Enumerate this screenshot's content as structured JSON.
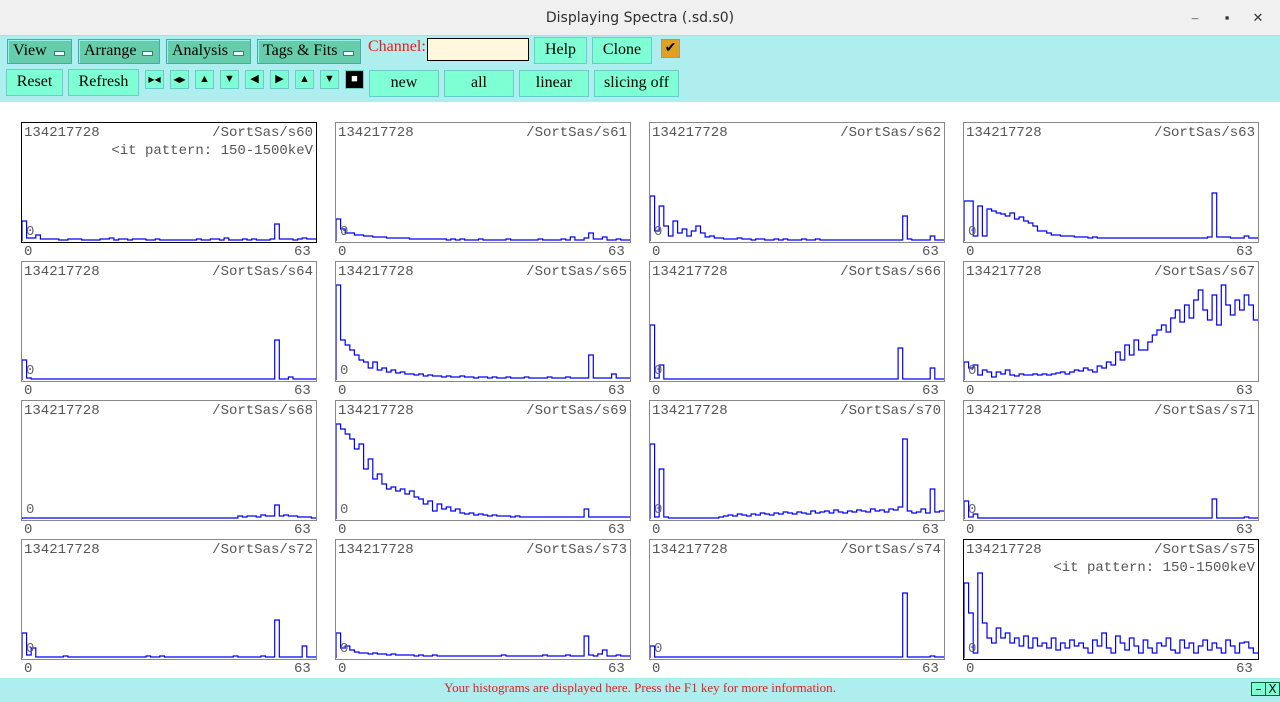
{
  "window": {
    "title": "Displaying Spectra (.sd.s0)",
    "minimize": "–",
    "maximize": "▪",
    "close": "✕"
  },
  "menus": [
    {
      "label": "View"
    },
    {
      "label": "Arrange"
    },
    {
      "label": "Analysis"
    },
    {
      "label": "Tags & Fits"
    }
  ],
  "channel": {
    "label": "Channel:",
    "value": ""
  },
  "buttons": {
    "help": "Help",
    "clone": "Clone",
    "reset": "Reset",
    "refresh": "Refresh",
    "new": "new",
    "all": "all",
    "linear": "linear",
    "slicing": "slicing off",
    "checkbox": "✔"
  },
  "nav_icons": [
    "▶◀",
    "◀▶",
    "▲",
    "▼",
    "◀",
    "▶",
    "▲",
    "▼",
    "■"
  ],
  "status": {
    "message": "Your histograms are displayed here. Press the F1 key for more information.",
    "minimize": "–",
    "close": "X"
  },
  "axis": {
    "min": "0",
    "max": "63",
    "zero": "0"
  },
  "spectra": [
    {
      "count": "134217728",
      "name": "/SortSas/s60",
      "subtitle": "<it pattern: 150-1500keV",
      "selected": true,
      "values": [
        20,
        3,
        3,
        6,
        2,
        2,
        2,
        2,
        1,
        1,
        2,
        2,
        2,
        1,
        1,
        1,
        1,
        2,
        2,
        3,
        1,
        2,
        2,
        1,
        2,
        2,
        2,
        1,
        1,
        2,
        1,
        1,
        1,
        1,
        1,
        1,
        1,
        1,
        2,
        1,
        1,
        2,
        2,
        1,
        3,
        1,
        1,
        1,
        2,
        1,
        2,
        1,
        1,
        1,
        2,
        17,
        2,
        2,
        2,
        1,
        2,
        3,
        2,
        2
      ]
    },
    {
      "count": "134217728",
      "name": "/SortSas/s61",
      "values": [
        22,
        12,
        8,
        8,
        6,
        6,
        5,
        5,
        4,
        4,
        4,
        3,
        3,
        3,
        3,
        3,
        2,
        2,
        2,
        2,
        2,
        2,
        2,
        2,
        1,
        2,
        1,
        2,
        1,
        1,
        1,
        2,
        1,
        1,
        1,
        1,
        1,
        2,
        1,
        1,
        1,
        1,
        1,
        1,
        2,
        1,
        1,
        1,
        1,
        2,
        1,
        4,
        1,
        1,
        3,
        8,
        2,
        2,
        4,
        1,
        1,
        2,
        1,
        1
      ]
    },
    {
      "count": "134217728",
      "name": "/SortSas/s62",
      "values": [
        45,
        10,
        35,
        15,
        5,
        20,
        8,
        12,
        5,
        10,
        15,
        8,
        4,
        5,
        3,
        3,
        2,
        2,
        2,
        3,
        2,
        2,
        1,
        2,
        2,
        1,
        1,
        2,
        1,
        2,
        1,
        1,
        1,
        2,
        1,
        1,
        2,
        1,
        1,
        1,
        1,
        1,
        1,
        1,
        1,
        1,
        1,
        1,
        1,
        1,
        1,
        1,
        1,
        1,
        1,
        25,
        2,
        1,
        1,
        1,
        1,
        5,
        1,
        1
      ]
    },
    {
      "count": "134217728",
      "name": "/SortSas/s63",
      "values": [
        40,
        40,
        5,
        35,
        5,
        32,
        30,
        28,
        27,
        25,
        28,
        22,
        24,
        20,
        18,
        15,
        10,
        10,
        8,
        6,
        6,
        5,
        5,
        5,
        4,
        4,
        4,
        3,
        4,
        3,
        3,
        3,
        3,
        3,
        3,
        3,
        3,
        3,
        3,
        3,
        3,
        3,
        3,
        3,
        3,
        3,
        3,
        3,
        3,
        3,
        3,
        3,
        3,
        4,
        48,
        4,
        4,
        4,
        3,
        3,
        3,
        5,
        3,
        3
      ]
    },
    {
      "count": "134217728",
      "name": "/SortSas/s64",
      "values": [
        20,
        2,
        1,
        1,
        1,
        1,
        1,
        1,
        1,
        1,
        1,
        1,
        1,
        1,
        1,
        1,
        1,
        1,
        1,
        1,
        1,
        1,
        1,
        1,
        1,
        1,
        1,
        1,
        1,
        1,
        1,
        1,
        1,
        1,
        1,
        1,
        1,
        1,
        1,
        1,
        1,
        1,
        1,
        1,
        1,
        1,
        1,
        1,
        1,
        1,
        1,
        1,
        1,
        1,
        1,
        40,
        1,
        1,
        3,
        1,
        1,
        1,
        1,
        1
      ]
    },
    {
      "count": "134217728",
      "name": "/SortSas/s65",
      "values": [
        95,
        40,
        35,
        30,
        25,
        20,
        18,
        12,
        18,
        10,
        12,
        8,
        10,
        7,
        8,
        6,
        6,
        5,
        6,
        4,
        5,
        4,
        4,
        3,
        4,
        3,
        3,
        4,
        3,
        3,
        2,
        3,
        3,
        2,
        3,
        2,
        2,
        3,
        2,
        2,
        2,
        3,
        2,
        2,
        2,
        2,
        3,
        2,
        2,
        2,
        3,
        2,
        2,
        2,
        2,
        25,
        2,
        2,
        2,
        2,
        6,
        2,
        2,
        2
      ]
    },
    {
      "count": "134217728",
      "name": "/SortSas/s66",
      "values": [
        55,
        2,
        15,
        1,
        1,
        1,
        1,
        1,
        1,
        1,
        1,
        1,
        1,
        1,
        1,
        1,
        1,
        1,
        1,
        1,
        1,
        1,
        1,
        1,
        1,
        1,
        1,
        1,
        1,
        1,
        1,
        1,
        1,
        1,
        1,
        1,
        1,
        1,
        1,
        1,
        1,
        1,
        1,
        1,
        1,
        1,
        1,
        1,
        1,
        1,
        1,
        1,
        1,
        1,
        32,
        1,
        1,
        1,
        1,
        1,
        1,
        12,
        1,
        1
      ]
    },
    {
      "count": "134217728",
      "name": "/SortSas/s67",
      "values": [
        18,
        12,
        15,
        5,
        10,
        8,
        3,
        8,
        6,
        10,
        5,
        4,
        6,
        5,
        5,
        6,
        5,
        6,
        5,
        6,
        7,
        8,
        6,
        8,
        10,
        9,
        12,
        10,
        8,
        14,
        12,
        18,
        15,
        28,
        20,
        35,
        25,
        40,
        30,
        30,
        38,
        45,
        50,
        55,
        48,
        62,
        70,
        58,
        75,
        62,
        80,
        90,
        70,
        60,
        85,
        55,
        95,
        75,
        65,
        80,
        70,
        85,
        75,
        60
      ]
    },
    {
      "count": "134217728",
      "name": "/SortSas/s68",
      "values": [
        1,
        1,
        1,
        1,
        1,
        1,
        1,
        1,
        1,
        1,
        1,
        1,
        1,
        1,
        1,
        1,
        1,
        1,
        1,
        1,
        1,
        1,
        1,
        1,
        1,
        1,
        1,
        1,
        1,
        1,
        1,
        1,
        1,
        1,
        1,
        1,
        1,
        1,
        1,
        1,
        1,
        1,
        1,
        1,
        1,
        1,
        1,
        3,
        2,
        3,
        3,
        2,
        4,
        3,
        3,
        14,
        3,
        4,
        3,
        3,
        2,
        2,
        2,
        1
      ]
    },
    {
      "count": "134217728",
      "name": "/SortSas/s69",
      "values": [
        95,
        90,
        85,
        80,
        70,
        75,
        50,
        60,
        40,
        45,
        35,
        30,
        32,
        28,
        30,
        25,
        28,
        22,
        20,
        15,
        18,
        8,
        15,
        10,
        12,
        8,
        10,
        6,
        5,
        6,
        4,
        5,
        4,
        3,
        4,
        3,
        3,
        3,
        2,
        3,
        2,
        2,
        2,
        2,
        2,
        2,
        2,
        2,
        2,
        2,
        2,
        2,
        2,
        2,
        10,
        2,
        2,
        2,
        2,
        2,
        2,
        2,
        2,
        2
      ]
    },
    {
      "count": "134217728",
      "name": "/SortSas/s70",
      "values": [
        75,
        2,
        50,
        2,
        1,
        1,
        1,
        1,
        1,
        1,
        1,
        1,
        1,
        1,
        1,
        2,
        3,
        4,
        3,
        5,
        4,
        3,
        5,
        4,
        6,
        5,
        4,
        6,
        5,
        7,
        6,
        5,
        7,
        6,
        5,
        8,
        6,
        7,
        8,
        6,
        9,
        7,
        6,
        8,
        7,
        9,
        8,
        7,
        10,
        8,
        9,
        7,
        10,
        9,
        12,
        80,
        8,
        6,
        7,
        10,
        6,
        30,
        7,
        8
      ]
    },
    {
      "count": "134217728",
      "name": "/SortSas/s71",
      "values": [
        18,
        2,
        5,
        1,
        1,
        1,
        1,
        1,
        1,
        1,
        1,
        1,
        1,
        1,
        1,
        1,
        1,
        1,
        1,
        1,
        1,
        1,
        1,
        1,
        1,
        1,
        1,
        1,
        1,
        1,
        1,
        1,
        1,
        1,
        1,
        1,
        1,
        1,
        1,
        1,
        1,
        1,
        1,
        1,
        1,
        1,
        1,
        1,
        1,
        1,
        1,
        1,
        1,
        1,
        20,
        1,
        1,
        1,
        1,
        1,
        1,
        2,
        1,
        1
      ]
    },
    {
      "count": "134217728",
      "name": "/SortSas/s72",
      "values": [
        25,
        3,
        10,
        1,
        1,
        1,
        1,
        1,
        1,
        2,
        1,
        1,
        1,
        1,
        1,
        1,
        1,
        1,
        1,
        1,
        1,
        1,
        1,
        1,
        1,
        1,
        1,
        2,
        1,
        1,
        2,
        1,
        1,
        1,
        1,
        1,
        1,
        1,
        1,
        1,
        1,
        1,
        1,
        1,
        1,
        1,
        2,
        1,
        1,
        1,
        1,
        1,
        2,
        1,
        1,
        38,
        1,
        1,
        1,
        1,
        1,
        12,
        1,
        1
      ]
    },
    {
      "count": "134217728",
      "name": "/SortSas/s73",
      "values": [
        25,
        10,
        12,
        8,
        6,
        5,
        5,
        4,
        5,
        4,
        4,
        3,
        4,
        3,
        3,
        3,
        3,
        2,
        3,
        2,
        2,
        3,
        2,
        2,
        2,
        2,
        2,
        2,
        2,
        2,
        2,
        2,
        2,
        2,
        2,
        2,
        3,
        2,
        2,
        2,
        2,
        2,
        2,
        2,
        2,
        3,
        2,
        2,
        2,
        2,
        3,
        2,
        2,
        2,
        22,
        3,
        2,
        4,
        8,
        2,
        2,
        3,
        2,
        2
      ]
    },
    {
      "count": "134217728",
      "name": "/SortSas/s74",
      "values": [
        12,
        1,
        1,
        1,
        1,
        1,
        1,
        1,
        1,
        1,
        1,
        1,
        1,
        1,
        1,
        1,
        1,
        1,
        1,
        1,
        1,
        1,
        1,
        1,
        1,
        1,
        1,
        1,
        1,
        1,
        1,
        1,
        1,
        1,
        1,
        1,
        1,
        1,
        1,
        1,
        1,
        1,
        1,
        1,
        1,
        1,
        1,
        1,
        1,
        1,
        1,
        1,
        1,
        1,
        1,
        65,
        1,
        1,
        1,
        1,
        1,
        2,
        1,
        1
      ]
    },
    {
      "count": "134217728",
      "name": "/SortSas/s75",
      "subtitle": "<it pattern: 150-1500keV",
      "selected": true,
      "values": [
        75,
        45,
        5,
        85,
        35,
        20,
        15,
        30,
        20,
        25,
        15,
        20,
        12,
        22,
        10,
        20,
        12,
        15,
        10,
        20,
        8,
        15,
        10,
        18,
        12,
        15,
        10,
        5,
        18,
        12,
        25,
        10,
        5,
        22,
        15,
        8,
        20,
        12,
        5,
        18,
        10,
        5,
        15,
        12,
        20,
        8,
        5,
        18,
        10,
        15,
        5,
        12,
        18,
        8,
        15,
        10,
        5,
        18,
        12,
        5,
        15,
        16,
        10,
        5
      ]
    }
  ]
}
